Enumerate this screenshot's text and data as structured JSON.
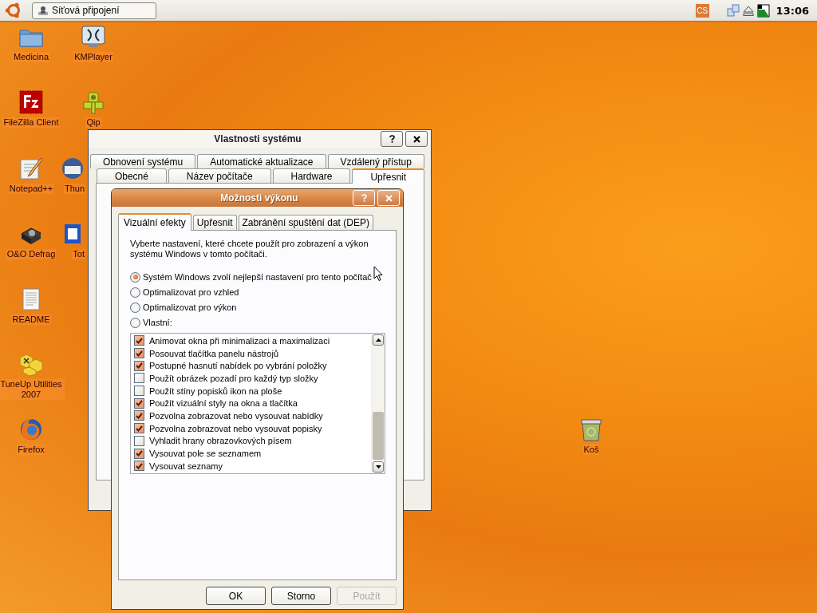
{
  "taskbar": {
    "tasks": [
      {
        "label": "Síťová připojení",
        "selected": false
      }
    ],
    "language": "CS",
    "clock": "13:06"
  },
  "desktop_icons": [
    {
      "label": "Medicina",
      "kind": "folder"
    },
    {
      "label": "KMPlayer",
      "kind": "player"
    },
    {
      "label": "FileZilla Client",
      "kind": "filezilla"
    },
    {
      "label": "Qip",
      "kind": "qip"
    },
    {
      "label": "Notepad++",
      "kind": "notepad"
    },
    {
      "label": "Thun",
      "kind": "mail"
    },
    {
      "label": "O&O Defrag",
      "kind": "defrag"
    },
    {
      "label": "Tot",
      "kind": "filemanager"
    },
    {
      "label": "README",
      "kind": "document"
    },
    {
      "label": "TuneUp Utilities 2007",
      "kind": "tuneup"
    },
    {
      "label": "Firefox",
      "kind": "firefox"
    },
    {
      "label": "Koš",
      "kind": "trash"
    }
  ],
  "system_properties": {
    "title": "Vlastnosti systému",
    "tab_rows": [
      [
        {
          "label": "Obnovení systému",
          "selected": false
        },
        {
          "label": "Automatické aktualizace",
          "selected": false
        },
        {
          "label": "Vzdálený přístup",
          "selected": false
        }
      ],
      [
        {
          "label": "Obecné",
          "selected": false
        },
        {
          "label": "Název počítače",
          "selected": false
        },
        {
          "label": "Hardware",
          "selected": false
        },
        {
          "label": "Upřesnit",
          "selected": true
        }
      ]
    ]
  },
  "performance_options": {
    "title": "Možnosti výkonu",
    "tabs": [
      {
        "label": "Vizuální efekty",
        "selected": true
      },
      {
        "label": "Upřesnit",
        "selected": false
      },
      {
        "label": "Zabránění spuštění dat (DEP)",
        "selected": false
      }
    ],
    "description": "Vyberte nastavení, které chcete použít pro zobrazení a výkon systému Windows v tomto počítači.",
    "options": [
      {
        "label": "Systém Windows zvolí nejlepší nastavení pro tento počítač",
        "selected": true
      },
      {
        "label": "Optimalizovat pro vzhled",
        "selected": false
      },
      {
        "label": "Optimalizovat pro výkon",
        "selected": false
      },
      {
        "label": "Vlastní:",
        "selected": false
      }
    ],
    "effects": [
      {
        "label": "Animovat okna při minimalizaci a maximalizaci",
        "checked": true
      },
      {
        "label": "Posouvat tlačítka panelu nástrojů",
        "checked": true
      },
      {
        "label": "Postupné hasnutí nabídek po vybrání položky",
        "checked": true
      },
      {
        "label": "Použít obrázek pozadí pro každý typ složky",
        "checked": false
      },
      {
        "label": "Použít stíny popisků ikon na ploše",
        "checked": false
      },
      {
        "label": "Použít vizuální styly na okna a tlačítka",
        "checked": true
      },
      {
        "label": "Pozvolna zobrazovat nebo vysouvat nabídky",
        "checked": true
      },
      {
        "label": "Pozvolna zobrazovat nebo vysouvat popisky",
        "checked": true
      },
      {
        "label": "Vyhladit hrany obrazovkových písem",
        "checked": false
      },
      {
        "label": "Vysouvat pole se seznamem",
        "checked": true
      },
      {
        "label": "Vysouvat seznamy",
        "checked": true
      }
    ],
    "buttons": [
      {
        "label": "OK",
        "disabled": false
      },
      {
        "label": "Storno",
        "disabled": false
      },
      {
        "label": "Použít",
        "disabled": true
      }
    ]
  }
}
